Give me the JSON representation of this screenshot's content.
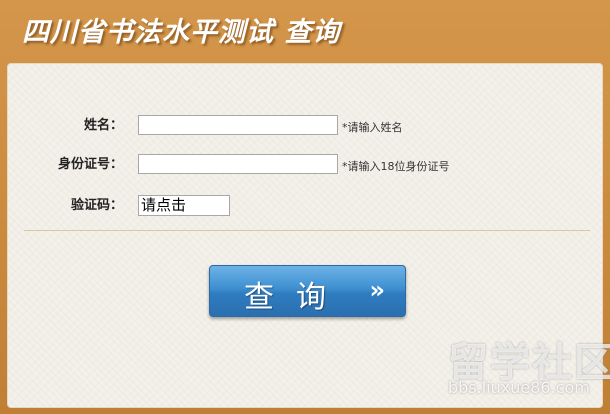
{
  "header": {
    "title": "四川省书法水平测试 查询"
  },
  "form": {
    "name": {
      "label": "姓名：",
      "value": "",
      "hint": "*请输入姓名"
    },
    "id_number": {
      "label": "身份证号：",
      "value": "",
      "hint": "*请输入18位身份证号"
    },
    "captcha": {
      "label": "验证码：",
      "text": "请点击"
    }
  },
  "query_button": {
    "label": "查询",
    "arrow": "»"
  },
  "watermark": {
    "brand": "留学社区",
    "url": "bbs.liuxue86.com"
  }
}
